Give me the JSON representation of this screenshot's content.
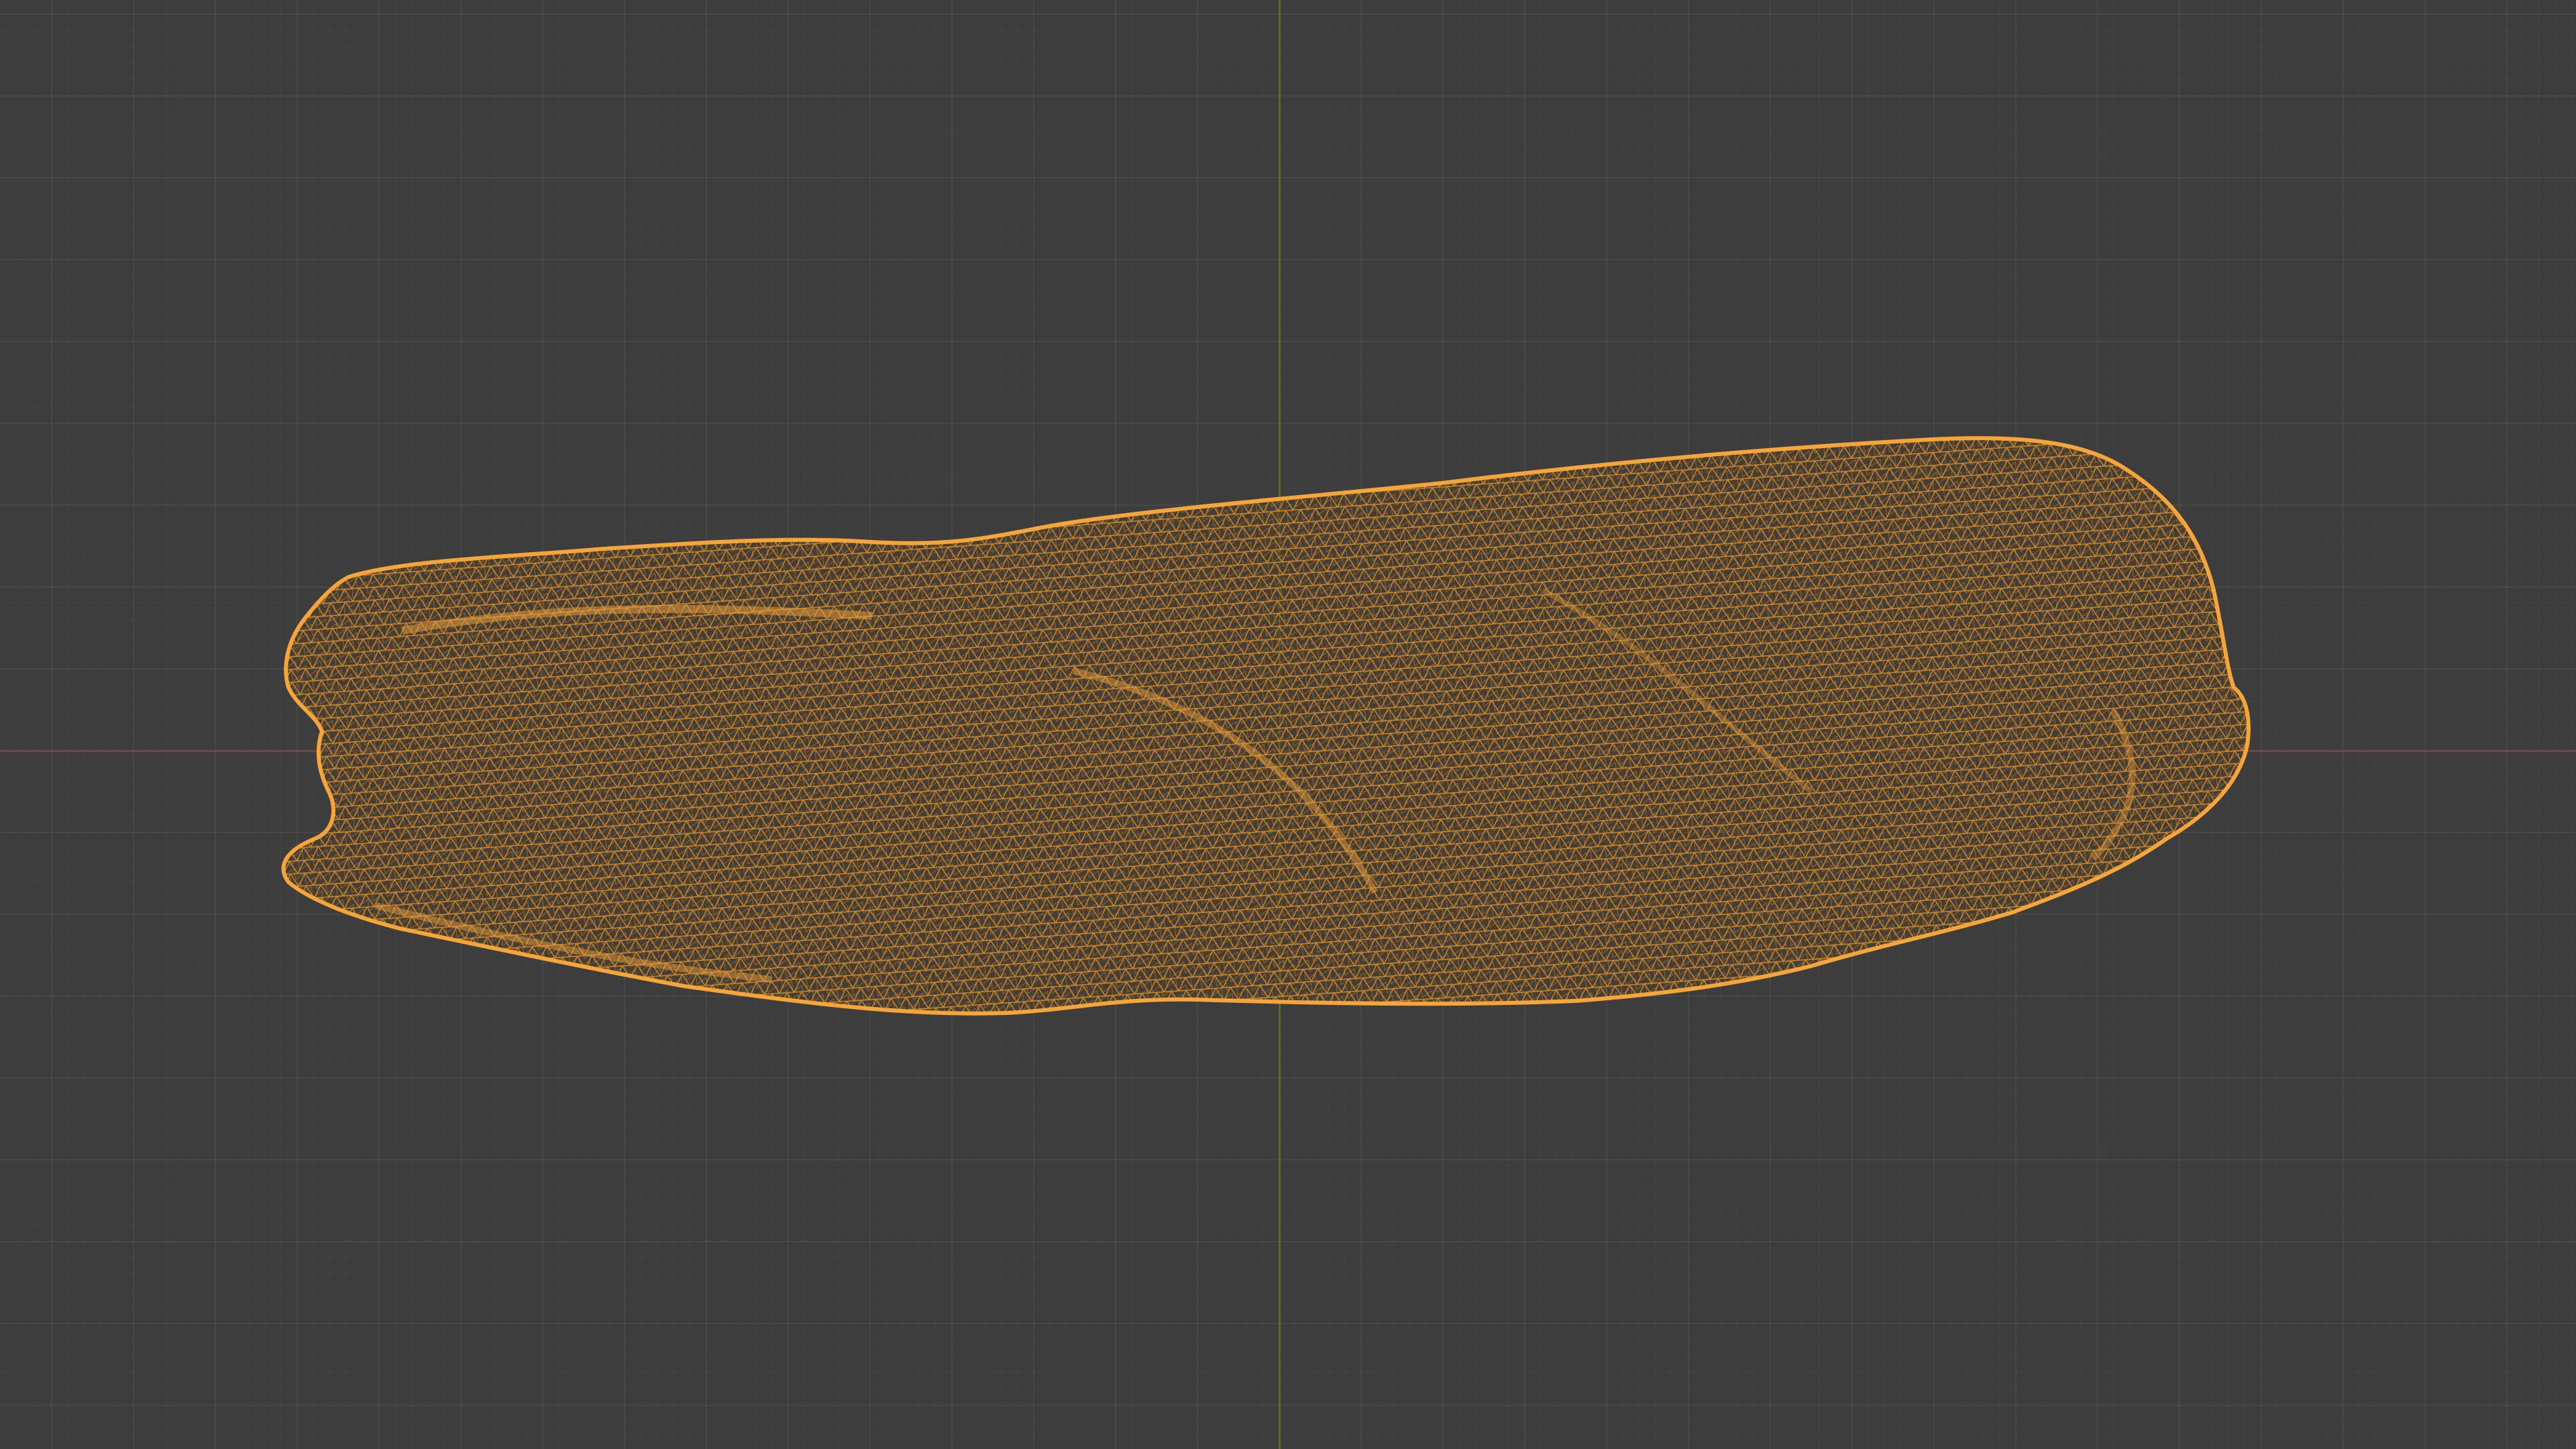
{
  "viewport": {
    "mode": "wireframe",
    "background_color": "#3d3d3d",
    "grid_color": "#4a4a4a"
  },
  "axes": {
    "x_axis_color": "#7a4a52",
    "y_axis_color": "#5f6e34"
  },
  "mesh": {
    "name": "",
    "selected": true,
    "wire_color": "#f0a030",
    "edge_highlight_color": "#ffb347",
    "shape": "elongated-rock"
  }
}
